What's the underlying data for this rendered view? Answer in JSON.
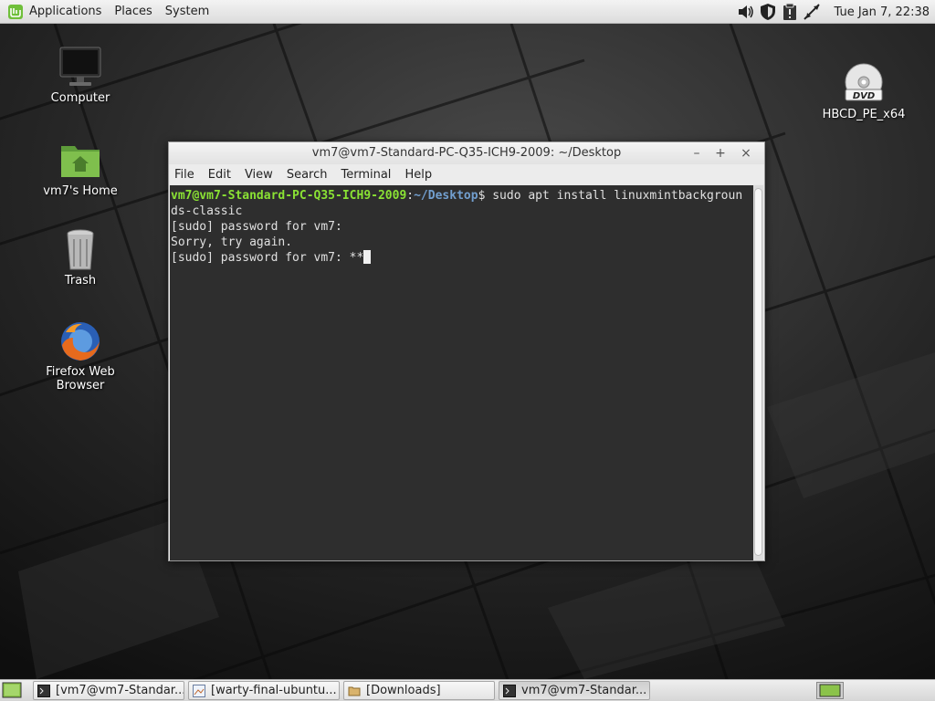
{
  "top_panel": {
    "menus": [
      "Applications",
      "Places",
      "System"
    ],
    "tray_icons": [
      "volume-icon",
      "shield-icon",
      "update-manager-icon",
      "network-icon"
    ],
    "clock": "Tue Jan  7, 22:38"
  },
  "desktop": {
    "icons": [
      {
        "label": "Computer",
        "icon": "computer-icon"
      },
      {
        "label": "vm7's Home",
        "icon": "home-folder-icon"
      },
      {
        "label": "Trash",
        "icon": "trash-icon"
      },
      {
        "label": "Firefox Web Browser",
        "icon": "firefox-icon"
      },
      {
        "label": "HBCD_PE_x64",
        "icon": "dvd-icon"
      }
    ]
  },
  "terminal": {
    "title": "vm7@vm7-Standard-PC-Q35-ICH9-2009: ~/Desktop",
    "menus": [
      "File",
      "Edit",
      "View",
      "Search",
      "Terminal",
      "Help"
    ],
    "prompt_user": "vm7@vm7-Standard-PC-Q35-ICH9-2009",
    "prompt_sep": ":",
    "prompt_path": "~/Desktop",
    "command": "$ sudo apt install linuxmintbackgroun",
    "command_wrap": "ds-classic",
    "lines": [
      "[sudo] password for vm7:",
      "Sorry, try again.",
      "[sudo] password for vm7: **"
    ]
  },
  "taskbar": {
    "items": [
      {
        "label": "[vm7@vm7-Standar...",
        "icon": "terminal-icon",
        "active": false
      },
      {
        "label": "[warty-final-ubuntu...",
        "icon": "image-viewer-icon",
        "active": false
      },
      {
        "label": "[Downloads]",
        "icon": "folder-icon",
        "active": false
      },
      {
        "label": "vm7@vm7-Standar...",
        "icon": "terminal-icon",
        "active": true
      }
    ]
  },
  "colors": {
    "prompt_user": "#8ae234",
    "prompt_path": "#729fcf",
    "terminal_bg": "#2e2e2e"
  }
}
